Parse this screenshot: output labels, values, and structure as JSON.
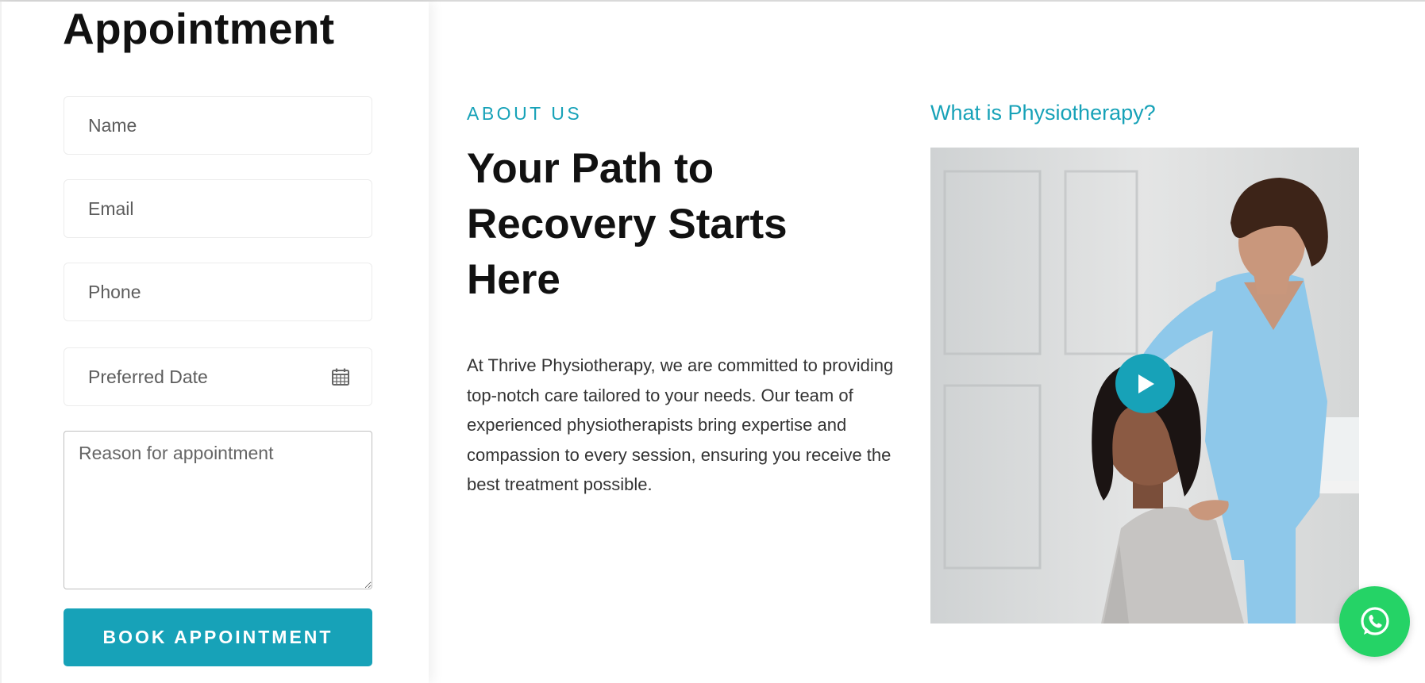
{
  "appointment_form": {
    "title": "Appointment",
    "name_placeholder": "Name",
    "email_placeholder": "Email",
    "phone_placeholder": "Phone",
    "date_placeholder": "Preferred Date",
    "reason_placeholder": "Reason for appointment",
    "submit_label": "BOOK APPOINTMENT"
  },
  "about": {
    "kicker": "ABOUT US",
    "title": "Your Path to Recovery Starts Here",
    "body": "At Thrive Physiotherapy, we are committed to providing top-notch care tailored to your needs. Our team of experienced physiotherapists bring expertise and compassion to every session, ensuring you receive the best treatment possible."
  },
  "video": {
    "heading": "What is Physiotherapy?",
    "thumbnail_alt": "Physiotherapist examining a patient's neck",
    "play_icon": "play-icon"
  },
  "floating": {
    "whatsapp_icon": "whatsapp-icon"
  },
  "colors": {
    "accent": "#17a2b8",
    "whatsapp": "#25d366",
    "heading": "#111111",
    "body_text": "#333333"
  }
}
